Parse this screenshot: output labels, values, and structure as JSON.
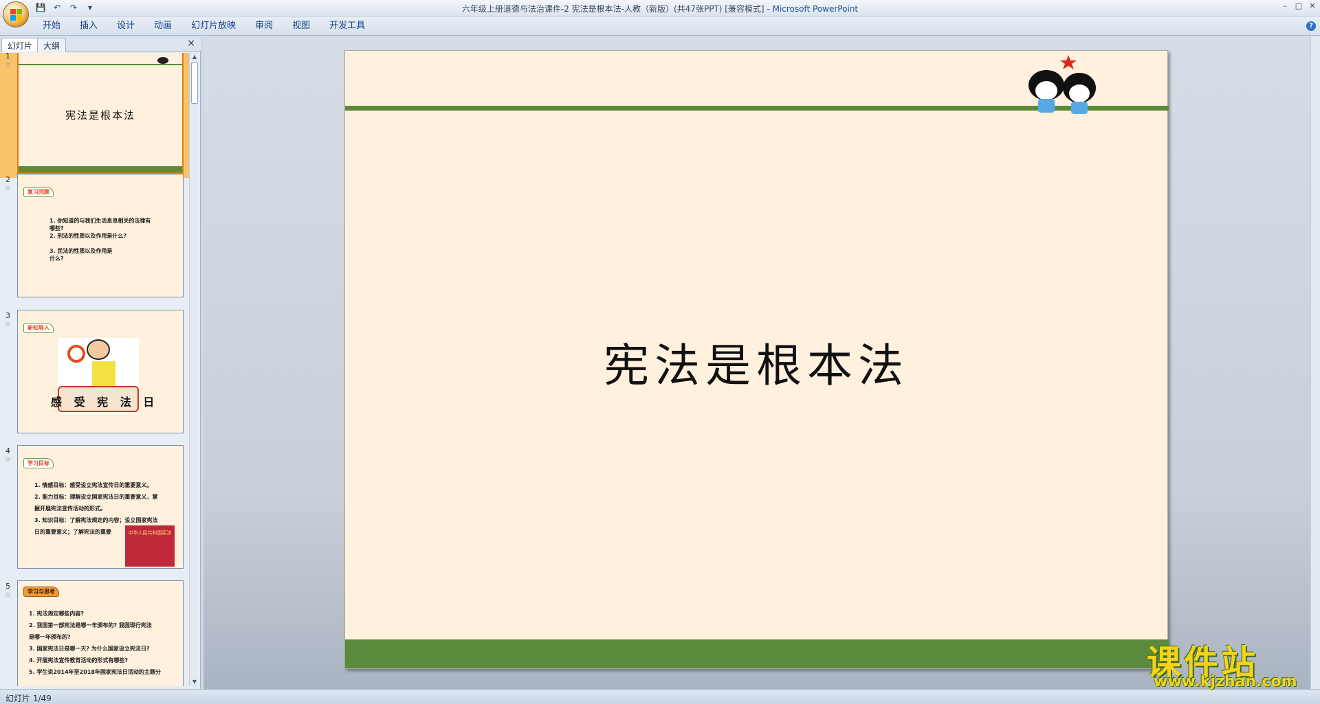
{
  "window": {
    "title_doc": "六年级上册道德与法治课件-2 宪法是根本法-人教（新版）(共47张PPT) [兼容模式]",
    "title_sep": " - ",
    "title_app": "Microsoft PowerPoint"
  },
  "ribbon": {
    "tabs": [
      "开始",
      "插入",
      "设计",
      "动画",
      "幻灯片放映",
      "审阅",
      "视图",
      "开发工具"
    ]
  },
  "pane": {
    "tab_slides": "幻灯片",
    "tab_outline": "大纲",
    "close": "×"
  },
  "thumbnails": [
    {
      "num": "1",
      "title": "宪法是根本法"
    },
    {
      "num": "2",
      "badge": "复习回顾",
      "lines": [
        "1. 你知道的与我们生活息息相关的法律有",
        "哪些?",
        "2. 刑法的性质以及作用是什么?",
        "3. 民法的性质以及作用是",
        "什么?"
      ]
    },
    {
      "num": "3",
      "badge": "新知导入",
      "caption": "感 受 宪 法 日"
    },
    {
      "num": "4",
      "badge": "学习目标",
      "lines": [
        "1. 情感目标：感受设立宪法宣传日的重要意义。",
        "2. 能力目标：理解设立国家宪法日的重要意义，掌",
        "握开展宪法宣传活动的形式。",
        "3. 知识目标：了解宪法规定的内容；设立国家宪法",
        "日的重要意义；了解宪法的重要"
      ],
      "book": "中华人民共和国宪法"
    },
    {
      "num": "5",
      "badge": "学习与思考",
      "lines": [
        "1. 宪法规定哪些内容?",
        "2. 我国第一部宪法是哪一年颁布的? 我国现行宪法",
        "是哪一年颁布的?",
        "3. 国家宪法日是哪一天? 为什么国家设立宪法日?",
        "4. 开展宪法宣传教育活动的形式有哪些?",
        "5. 学生说2014年至2018年国家宪法日活动的主题分"
      ]
    }
  ],
  "slide": {
    "title": "宪法是根本法"
  },
  "status": {
    "slide_indicator": "幻灯片 1/49"
  },
  "watermark": {
    "big": "课件站",
    "url": "www.kjzhan.com"
  },
  "colors": {
    "slide_bg": "#fff1de",
    "green_bar": "#5b8a3a",
    "selected_thumb": "#f8c36b",
    "ribbon_text": "#15428b"
  }
}
